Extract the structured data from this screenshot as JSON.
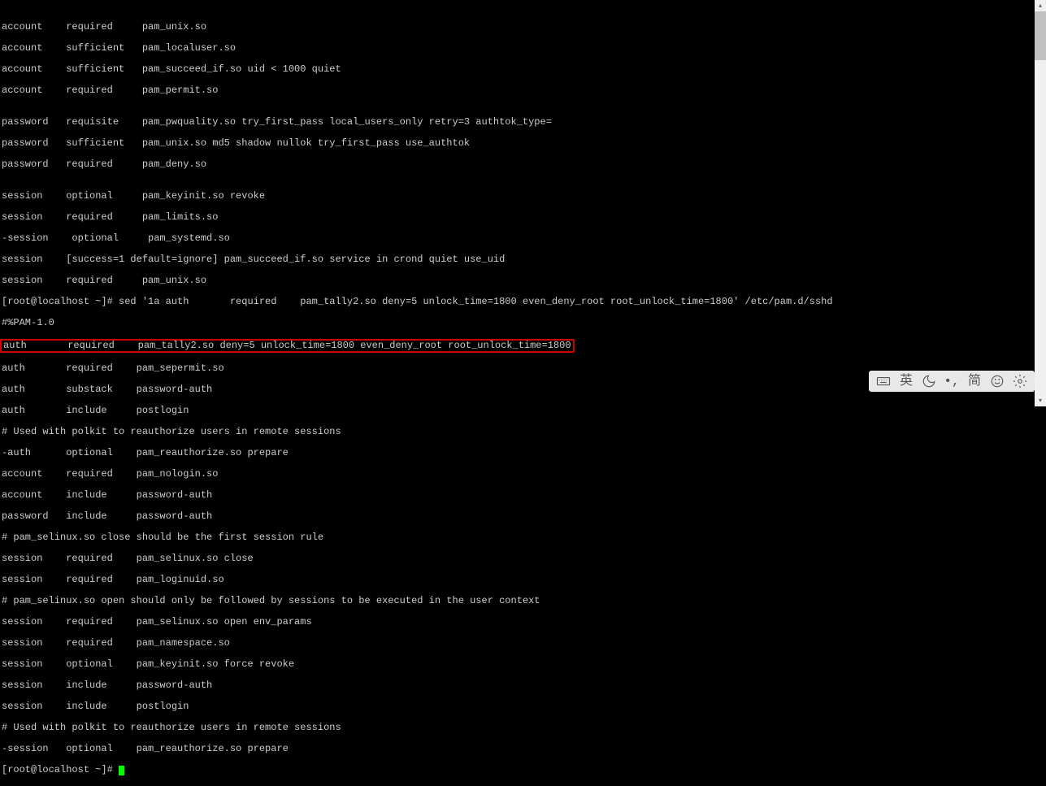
{
  "lines": [
    "account    required     pam_unix.so",
    "account    sufficient   pam_localuser.so",
    "account    sufficient   pam_succeed_if.so uid < 1000 quiet",
    "account    required     pam_permit.so",
    "",
    "password   requisite    pam_pwquality.so try_first_pass local_users_only retry=3 authtok_type=",
    "password   sufficient   pam_unix.so md5 shadow nullok try_first_pass use_authtok",
    "password   required     pam_deny.so",
    "",
    "session    optional     pam_keyinit.so revoke",
    "session    required     pam_limits.so",
    "-session    optional     pam_systemd.so",
    "session    [success=1 default=ignore] pam_succeed_if.so service in crond quiet use_uid",
    "session    required     pam_unix.so",
    "[root@localhost ~]# sed '1a auth       required    pam_tally2.so deny=5 unlock_time=1800 even_deny_root root_unlock_time=1800' /etc/pam.d/sshd",
    "#%PAM-1.0"
  ],
  "highlighted_line": "auth       required    pam_tally2.so deny=5 unlock_time=1800 even_deny_root root_unlock_time=1800",
  "lines_after": [
    "auth       required    pam_sepermit.so",
    "auth       substack    password-auth",
    "auth       include     postlogin",
    "# Used with polkit to reauthorize users in remote sessions",
    "-auth      optional    pam_reauthorize.so prepare",
    "account    required    pam_nologin.so",
    "account    include     password-auth",
    "password   include     password-auth",
    "# pam_selinux.so close should be the first session rule",
    "session    required    pam_selinux.so close",
    "session    required    pam_loginuid.so",
    "# pam_selinux.so open should only be followed by sessions to be executed in the user context",
    "session    required    pam_selinux.so open env_params",
    "session    required    pam_namespace.so",
    "session    optional    pam_keyinit.so force revoke",
    "session    include     password-auth",
    "session    include     postlogin",
    "# Used with polkit to reauthorize users in remote sessions",
    "-session   optional    pam_reauthorize.so prepare"
  ],
  "prompt": "[root@localhost ~]# ",
  "ime": {
    "keyboard": "⌨",
    "lang": "英",
    "moon": "☽",
    "punct": "•,",
    "simp": "简",
    "emoji": "☺",
    "gear": "⚙"
  }
}
